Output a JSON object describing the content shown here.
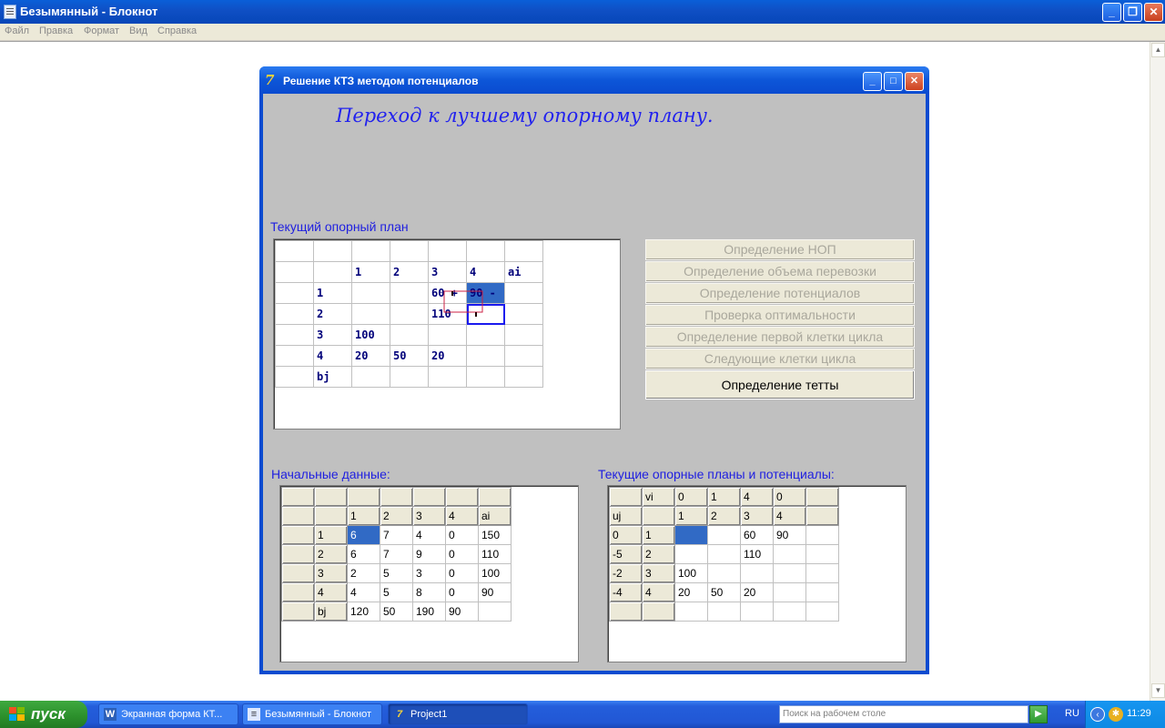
{
  "notepad": {
    "title": "Безымянный - Блокнот",
    "menu": [
      "Файл",
      "Правка",
      "Формат",
      "Вид",
      "Справка"
    ]
  },
  "app": {
    "title": "Решение КТЗ методом потенциалов",
    "heading": "Переход к лучшему опорному плану.",
    "current_plan_label": "Текущий опорный план",
    "initial_data_label": "Начальные данные:",
    "potentials_label": "Текущие опорные планы и потенциалы:",
    "plan_table": [
      [
        "",
        "",
        "",
        "",
        "",
        "",
        ""
      ],
      [
        "",
        "",
        "1",
        "2",
        "3",
        "4",
        "ai"
      ],
      [
        "",
        "1",
        "",
        "",
        "60 +",
        "90 -",
        ""
      ],
      [
        "",
        "2",
        "",
        "",
        "110",
        "",
        ""
      ],
      [
        "",
        "3",
        "100",
        "",
        "",
        "",
        ""
      ],
      [
        "",
        "4",
        "20",
        "50",
        "20",
        "",
        ""
      ],
      [
        "",
        "bj",
        "",
        "",
        "",
        "",
        ""
      ]
    ],
    "buttons": [
      "Определение НОП",
      "Определение объема перевозки",
      "Определение потенциалов",
      "Проверка оптимальности",
      "Определение первой клетки цикла",
      "Следующие клетки цикла",
      "Определение тетты"
    ],
    "initial_table": [
      [
        "",
        "",
        "",
        "",
        "",
        "",
        ""
      ],
      [
        "",
        "",
        "1",
        "2",
        "3",
        "4",
        "ai"
      ],
      [
        "",
        "1",
        "6",
        "7",
        "4",
        "0",
        "150"
      ],
      [
        "",
        "2",
        "6",
        "7",
        "9",
        "0",
        "110"
      ],
      [
        "",
        "3",
        "2",
        "5",
        "3",
        "0",
        "100"
      ],
      [
        "",
        "4",
        "4",
        "5",
        "8",
        "0",
        "90"
      ],
      [
        "",
        "bj",
        "120",
        "50",
        "190",
        "90",
        ""
      ]
    ],
    "potentials_table": [
      [
        "",
        "vi",
        "0",
        "1",
        "4",
        "0",
        ""
      ],
      [
        "uj",
        "",
        "1",
        "2",
        "3",
        "4",
        ""
      ],
      [
        "0",
        "1",
        "",
        "",
        "60",
        "90",
        ""
      ],
      [
        "-5",
        "2",
        "",
        "",
        "110",
        "",
        ""
      ],
      [
        "-2",
        "3",
        "100",
        "",
        "",
        "",
        ""
      ],
      [
        "-4",
        "4",
        "20",
        "50",
        "20",
        "",
        ""
      ],
      [
        "",
        "",
        "",
        "",
        "",
        "",
        ""
      ]
    ]
  },
  "taskbar": {
    "start_label": "пуск",
    "tasks": [
      "Экранная форма КТ...",
      "Безымянный - Блокнот",
      "Project1"
    ],
    "search_placeholder": "Поиск на рабочем столе",
    "language": "RU",
    "clock": "11:29"
  }
}
